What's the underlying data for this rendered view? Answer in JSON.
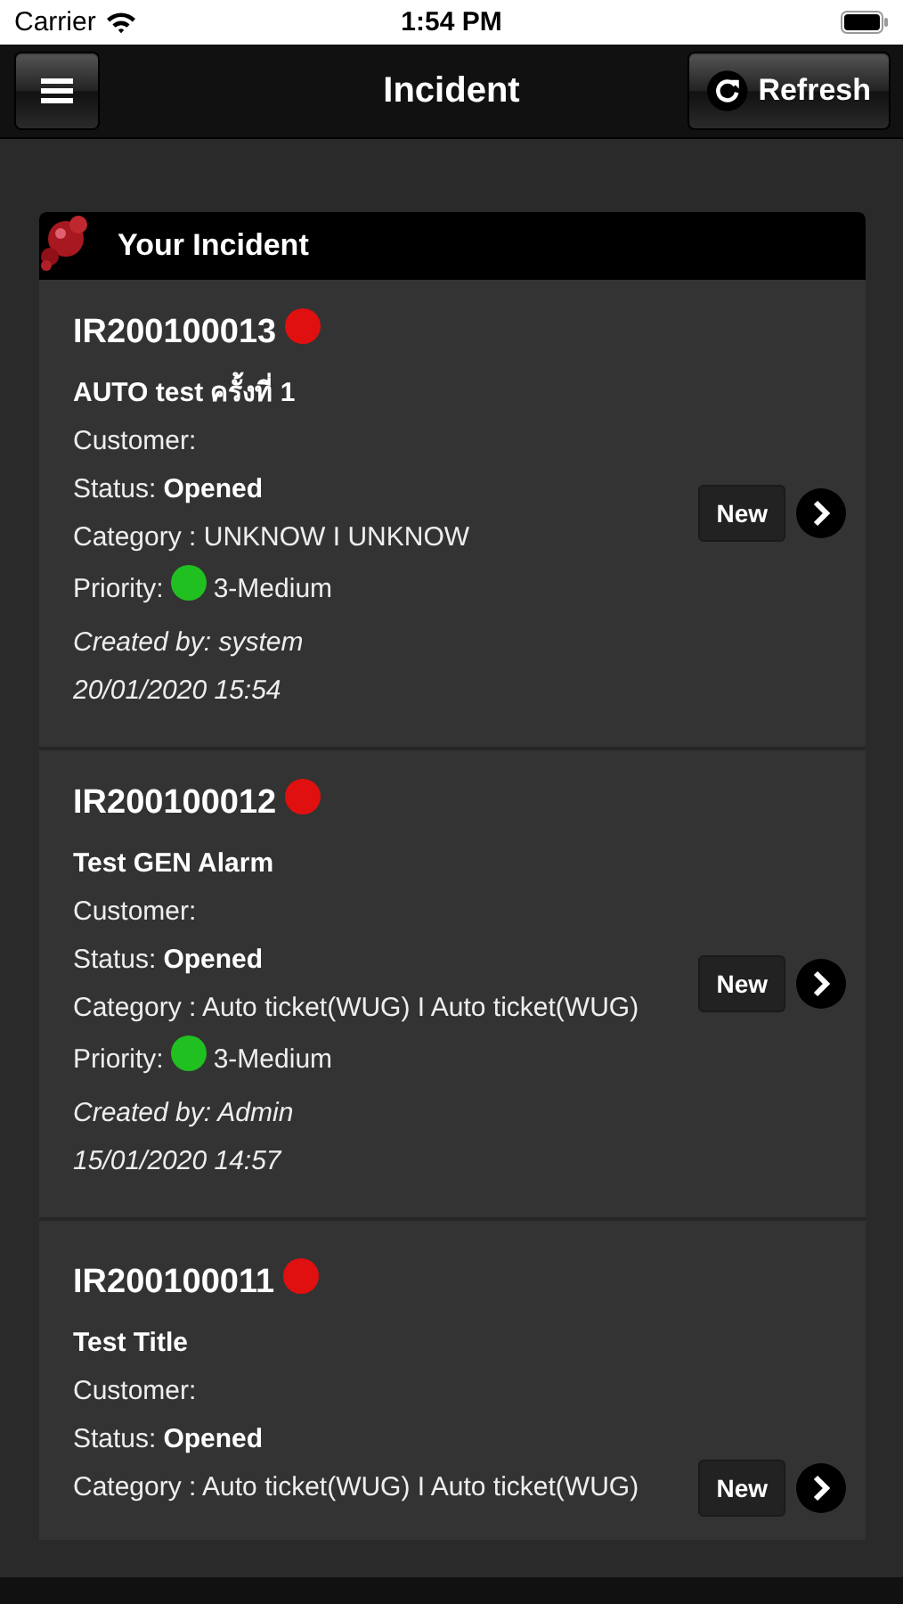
{
  "status_bar": {
    "carrier": "Carrier",
    "time": "1:54 PM"
  },
  "nav": {
    "title": "Incident",
    "refresh": "Refresh"
  },
  "panel": {
    "title": "Your Incident"
  },
  "incidents": [
    {
      "id": "IR200100013",
      "status_dot": {
        "color": "#e01010"
      },
      "title": "AUTO test ครั้งที่ 1",
      "customer_label": "Customer:",
      "status_label": "Status:",
      "status": "Opened",
      "category": "Category : UNKNOW I UNKNOW",
      "priority_label": "Priority:",
      "priority_dot": {
        "color": "#20c020"
      },
      "priority": "3-Medium",
      "created_by": "Created by: system",
      "date": "20/01/2020 15:54",
      "badge": "New"
    },
    {
      "id": "IR200100012",
      "status_dot": {
        "color": "#e01010"
      },
      "title": "Test GEN Alarm",
      "customer_label": "Customer:",
      "status_label": "Status:",
      "status": "Opened",
      "category": "Category : Auto ticket(WUG) I Auto ticket(WUG)",
      "priority_label": "Priority:",
      "priority_dot": {
        "color": "#20c020"
      },
      "priority": "3-Medium",
      "created_by": "Created by: Admin",
      "date": "15/01/2020 14:57",
      "badge": "New"
    },
    {
      "id": "IR200100011",
      "status_dot": {
        "color": "#e01010"
      },
      "title": "Test Title",
      "customer_label": "Customer:",
      "status_label": "Status:",
      "status": "Opened",
      "category": "Category : Auto ticket(WUG) I Auto ticket(WUG)",
      "badge": "New"
    }
  ]
}
